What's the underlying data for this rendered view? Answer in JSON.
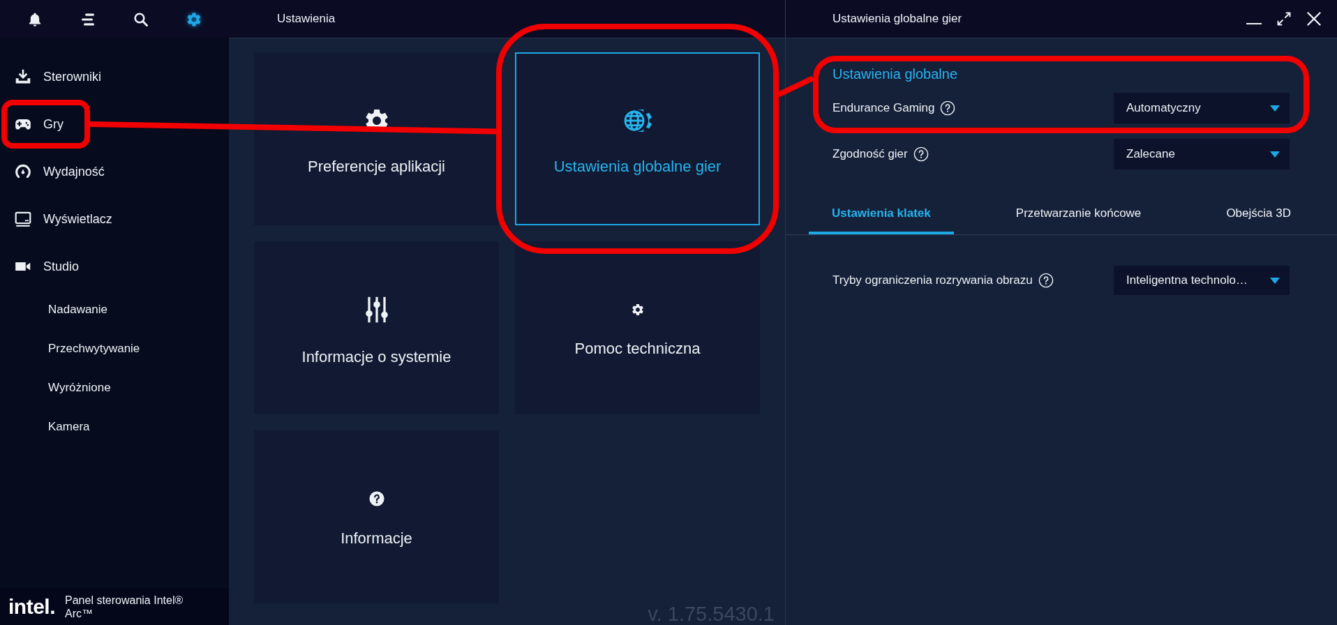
{
  "sidebar": {
    "top_icons": [
      {
        "selected": false
      },
      {
        "selected": false
      },
      {
        "selected": false
      },
      {
        "selected": true
      }
    ],
    "items": [
      {
        "label": "Sterowniki",
        "highlighted": false
      },
      {
        "label": "Gry",
        "highlighted": true
      },
      {
        "label": "Wydajność",
        "highlighted": false
      },
      {
        "label": "Wyświetlacz",
        "highlighted": false
      },
      {
        "label": "Studio",
        "highlighted": false,
        "children": [
          {
            "label": "Nadawanie",
            "highlighted": false
          },
          {
            "label": "Przechwytywanie",
            "highlighted": false
          },
          {
            "label": "Wyróżnione",
            "highlighted": false
          },
          {
            "label": "Kamera",
            "highlighted": false
          }
        ]
      }
    ],
    "brand": {
      "logo": "intel.",
      "name": "Panel sterowania Intel® Arc™"
    }
  },
  "main": {
    "title": "Ustawienia",
    "tiles": [
      {
        "label": "Preferencje aplikacji",
        "selected": false,
        "highlighted": false
      },
      {
        "label": "Ustawienia globalne gier",
        "selected": true,
        "highlighted": true
      },
      {
        "label": "Informacje o systemie",
        "selected": false,
        "highlighted": false
      },
      {
        "label": "Pomoc techniczna",
        "selected": false,
        "highlighted": false
      },
      {
        "label": "Informacje",
        "selected": false,
        "highlighted": false
      }
    ],
    "version": "v. 1.75.5430.1"
  },
  "panel": {
    "title": "Ustawienia globalne gier",
    "section": {
      "title": "Ustawienia globalne",
      "highlighted": true,
      "settings": [
        {
          "label": "Endurance Gaming",
          "value": "Automatyczny"
        }
      ]
    },
    "settings": [
      {
        "label": "Zgodność gier",
        "value": "Zalecane"
      }
    ],
    "tabs": [
      {
        "label": "Ustawienia klatek",
        "selected": true
      },
      {
        "label": "Przetwarzanie końcowe",
        "selected": false
      },
      {
        "label": "Obejścia 3D",
        "selected": false
      }
    ],
    "tab_settings": [
      {
        "label": "Tryby ograniczenia rozrywania obrazu",
        "value": "Inteligentna technolo…"
      }
    ]
  }
}
